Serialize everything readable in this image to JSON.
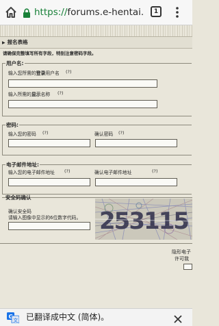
{
  "browser": {
    "url_scheme": "https://",
    "url_host": "forums.e-hentai.org/ir",
    "tab_count": "1"
  },
  "form": {
    "section_title": "报名表格",
    "hint": "请确保完整填写所有字段，特别注意密码字段。",
    "username": {
      "legend": "用户名:",
      "login_label_prefix": "输入您所需的",
      "login_label_bold": "登录",
      "login_label_suffix": "用户名",
      "display_label_prefix": "输入所需的",
      "display_label_bold": "显示",
      "display_label_suffix": "名称",
      "help": "(?)"
    },
    "password": {
      "legend": "密码:",
      "enter_label": "输入您的密码",
      "confirm_label": "确认密码",
      "help": "(?)"
    },
    "email": {
      "legend": "电子邮件地址:",
      "enter_label": "输入您的电子邮件地址",
      "confirm_label": "确认电子邮件地址",
      "help": "(?)"
    },
    "security": {
      "legend": "安全码确认",
      "confirm_label": "确认安全码",
      "instruction": "请输入图像中显示的6位数字代码。",
      "captcha_text": "253115"
    },
    "side_text_1": "隐形电子",
    "side_text_2": "许可我"
  },
  "translate_bar": {
    "message": "已翻译成中文 (简体)。"
  }
}
